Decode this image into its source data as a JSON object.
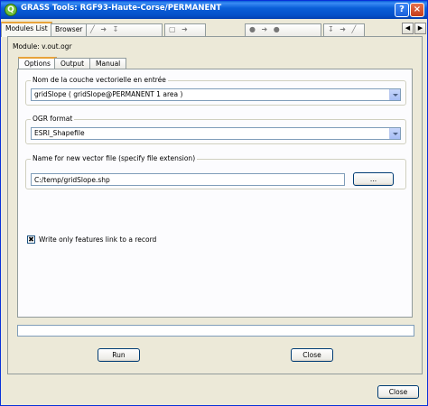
{
  "window": {
    "title": "GRASS Tools: RGF93-Haute-Corse/PERMANENT",
    "icon_glyph": "Q",
    "help_glyph": "?",
    "close_glyph": "×"
  },
  "toptabs": {
    "modules_list": "Modules List",
    "browser": "Browser",
    "scroll_left": "◀",
    "scroll_right": "▶"
  },
  "module": {
    "label": "Module: v.out.ogr",
    "tabs": [
      "Options",
      "Output",
      "Manual"
    ],
    "active_tab": "Options"
  },
  "options": {
    "layer_group_title": "Nom de la couche vectorielle en entrée",
    "layer_value": "gridSlope ( gridSlope@PERMANENT 1 area )",
    "format_group_title": "OGR format",
    "format_value": "ESRI_Shapefile",
    "file_group_title": "Name for new vector file (specify file extension)",
    "file_value": "C:/temp/gridSlope.shp",
    "browse_label": "...",
    "checkbox_label": "Write only features link to a record",
    "checkbox_checked": true,
    "checkbox_glyph": "✖"
  },
  "progress": {
    "value": 0
  },
  "actions": {
    "run_label": "Run",
    "close_label": "Close"
  },
  "footer": {
    "close_label": "Close"
  },
  "colors": {
    "titlebar": "#0a5fd8",
    "face": "#ece9d8",
    "tab_accent": "#e8a33b"
  }
}
